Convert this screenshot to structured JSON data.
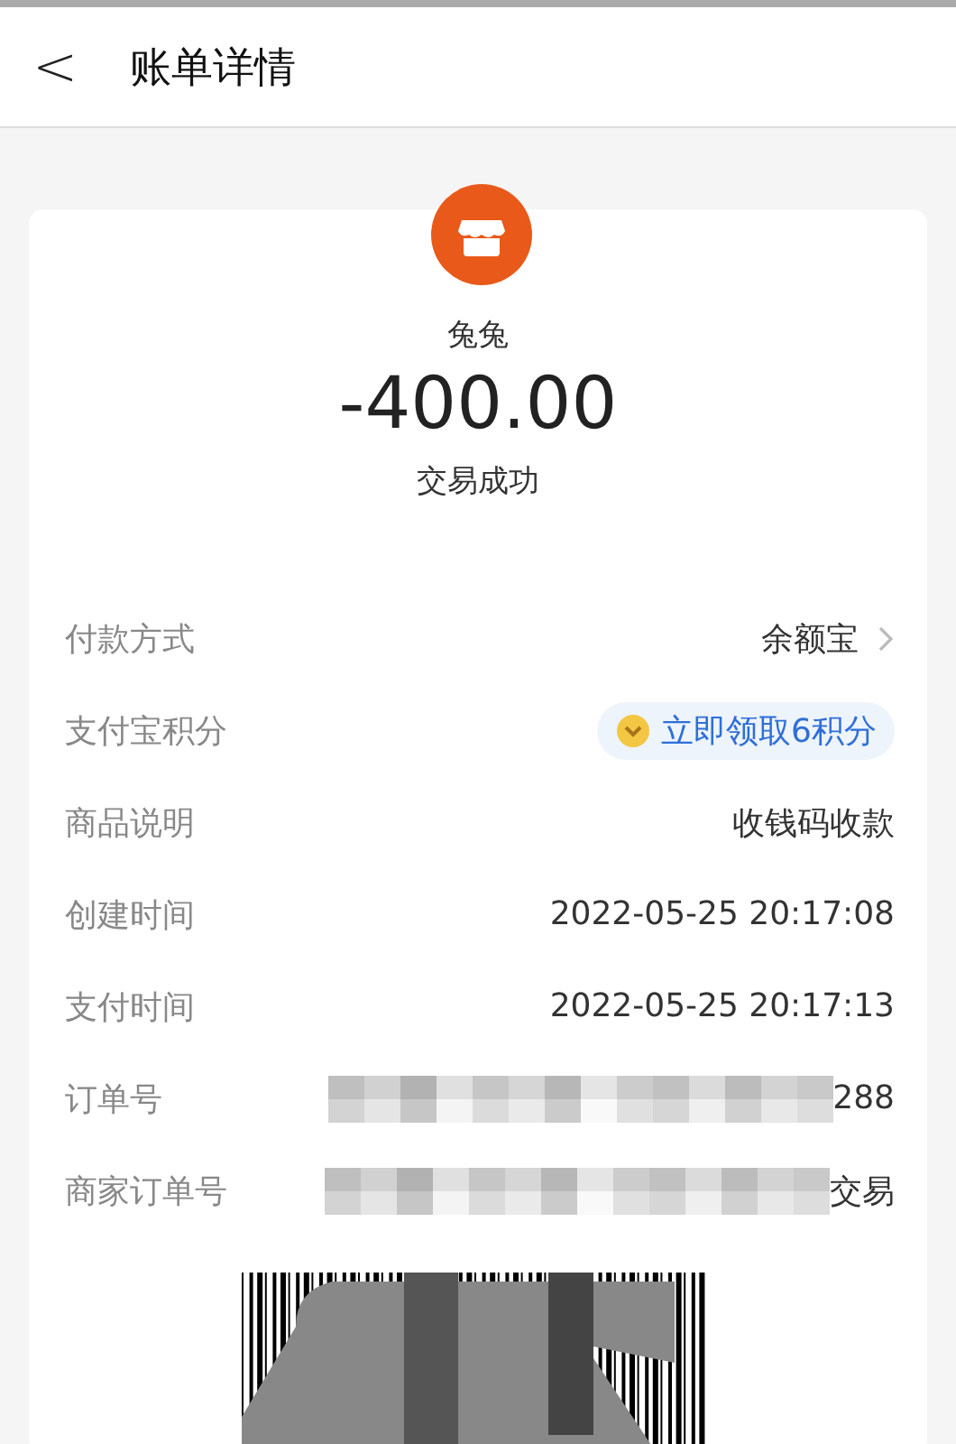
{
  "header": {
    "back": "<",
    "title": "账单详情"
  },
  "summary": {
    "payee": "兔兔",
    "amount": "-400.00",
    "status": "交易成功"
  },
  "rows": [
    {
      "kind": "link",
      "label": "付款方式",
      "value": "余额宝"
    },
    {
      "kind": "badge",
      "label": "支付宝积分",
      "value": "立即领取6积分"
    },
    {
      "kind": "text",
      "label": "商品说明",
      "value": "收钱码收款"
    },
    {
      "kind": "text",
      "label": "创建时间",
      "value": "2022-05-25 20:17:08"
    },
    {
      "kind": "text",
      "label": "支付时间",
      "value": "2022-05-25 20:17:13"
    },
    {
      "kind": "redacted",
      "label": "订单号",
      "value": "288"
    },
    {
      "kind": "redacted",
      "label": "商家订单号",
      "value": "交易"
    }
  ]
}
